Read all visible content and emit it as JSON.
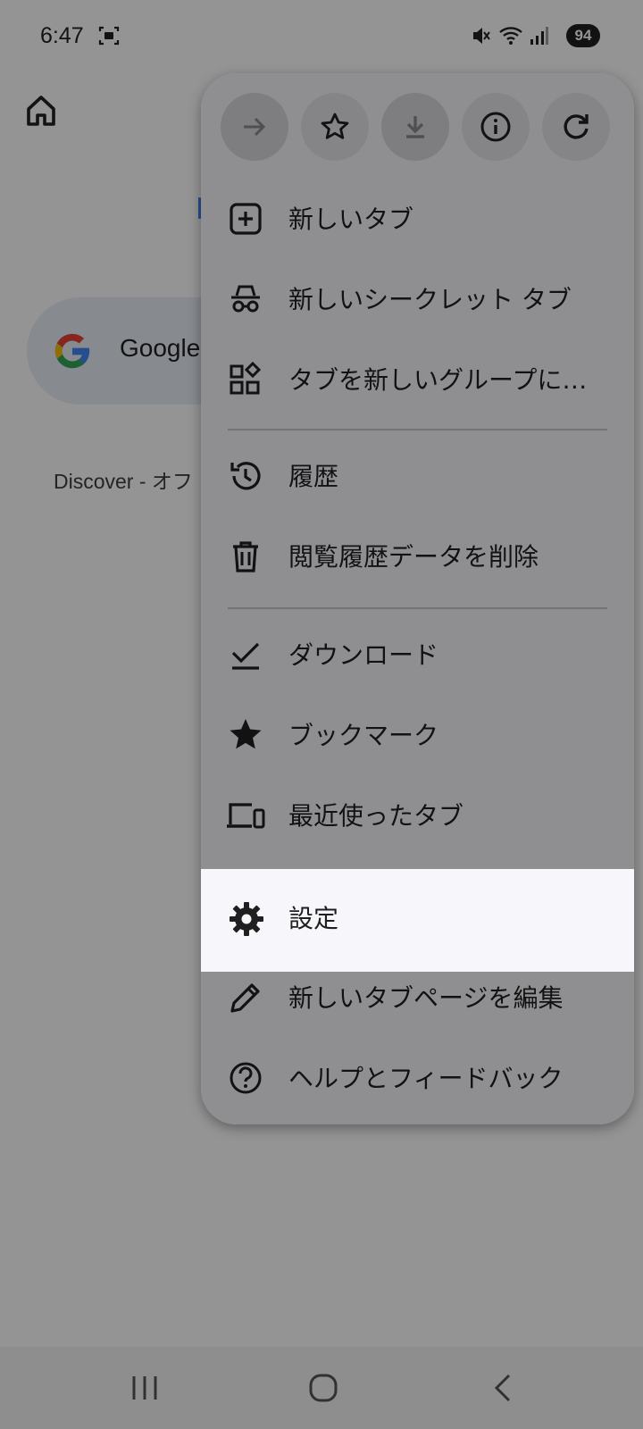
{
  "status_bar": {
    "time": "6:47",
    "battery": "94",
    "icons": [
      "screenshot-icon",
      "mute-icon",
      "wifi-icon",
      "signal-icon"
    ]
  },
  "background_page": {
    "search_text": "Google",
    "discover_text": "Discover - オフ"
  },
  "menu": {
    "top_actions": [
      {
        "name": "forward-icon",
        "enabled": false
      },
      {
        "name": "bookmark-star-icon",
        "enabled": true
      },
      {
        "name": "download-icon",
        "enabled": false
      },
      {
        "name": "info-icon",
        "enabled": true
      },
      {
        "name": "reload-icon",
        "enabled": true
      }
    ],
    "items": [
      {
        "label": "新しいタブ",
        "icon": "new-tab-icon"
      },
      {
        "label": "新しいシークレット タブ",
        "icon": "incognito-icon"
      },
      {
        "label": "タブを新しいグループに追加",
        "icon": "tab-group-icon"
      },
      {
        "label": "履歴",
        "icon": "history-icon"
      },
      {
        "label": "閲覧履歴データを削除",
        "icon": "trash-icon"
      },
      {
        "label": "ダウンロード",
        "icon": "downloads-check-icon"
      },
      {
        "label": "ブックマーク",
        "icon": "bookmarks-star-icon"
      },
      {
        "label": "最近使ったタブ",
        "icon": "devices-icon"
      },
      {
        "label": "設定",
        "icon": "settings-gear-icon",
        "highlighted": true
      },
      {
        "label": "新しいタブページを編集",
        "icon": "pencil-icon"
      },
      {
        "label": "ヘルプとフィードバック",
        "icon": "help-icon"
      }
    ]
  },
  "nav_bar": {
    "buttons": [
      "recents-icon",
      "home-circle-icon",
      "back-icon"
    ]
  }
}
